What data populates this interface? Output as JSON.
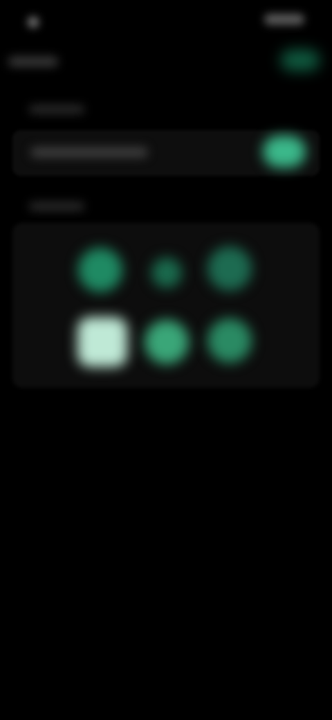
{
  "status_bar": {
    "time": ""
  },
  "header": {
    "title": ""
  },
  "toggle_row": {
    "state": "on"
  },
  "grid": {
    "items": [
      {
        "icon": "circle-icon",
        "selected": false
      },
      {
        "icon": "circle-icon",
        "selected": false
      },
      {
        "icon": "circle-icon",
        "selected": false
      },
      {
        "icon": "square-icon",
        "selected": true
      },
      {
        "icon": "circle-icon",
        "selected": false
      },
      {
        "icon": "circle-icon",
        "selected": false
      }
    ]
  },
  "colors": {
    "background": "#000000",
    "accent": "#3bb88a",
    "card": "#0d0d0d",
    "selected": "#bfe9d6"
  }
}
